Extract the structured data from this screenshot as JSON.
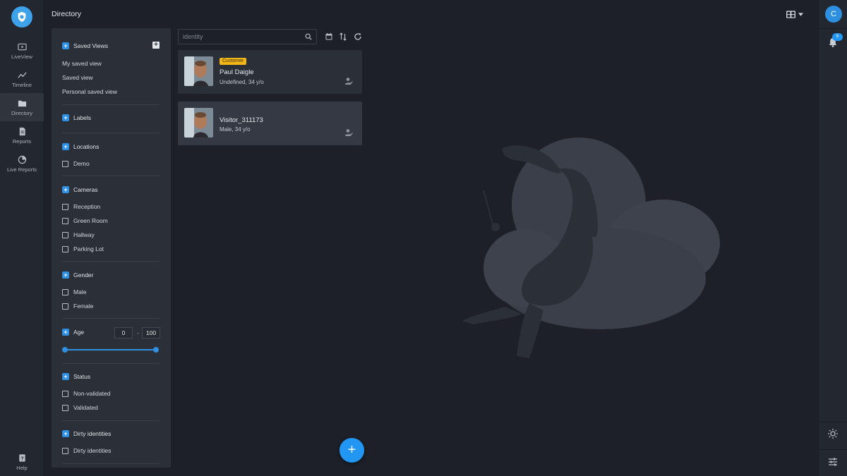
{
  "nav": {
    "items": [
      {
        "label": "LiveView",
        "icon": "tv-play-icon"
      },
      {
        "label": "Timeline",
        "icon": "trend-line-icon"
      },
      {
        "label": "Directory",
        "icon": "folder-icon"
      },
      {
        "label": "Reports",
        "icon": "document-icon"
      },
      {
        "label": "Live Reports",
        "icon": "pie-chart-icon"
      }
    ],
    "help_label": "Help",
    "active": "Directory"
  },
  "header": {
    "title": "Directory"
  },
  "user": {
    "initial": "C",
    "notifications": "6"
  },
  "filters": {
    "saved_views": {
      "title": "Saved Views",
      "items": [
        "My saved view",
        "Saved view",
        "Personal saved view"
      ]
    },
    "labels": {
      "title": "Labels"
    },
    "locations": {
      "title": "Locations",
      "items": [
        "Demo"
      ]
    },
    "cameras": {
      "title": "Cameras",
      "items": [
        "Reception",
        "Green Room",
        "Hallway",
        "Parking Lot"
      ]
    },
    "gender": {
      "title": "Gender",
      "items": [
        "Male",
        "Female"
      ]
    },
    "age": {
      "title": "Age",
      "min": "0",
      "max": "100",
      "separator": "-"
    },
    "status": {
      "title": "Status",
      "items": [
        "Non-validated",
        "Validated"
      ]
    },
    "dirty": {
      "title": "Dirty identities",
      "items": [
        "Dirty identities"
      ]
    }
  },
  "search": {
    "placeholder": "identity",
    "value": ""
  },
  "results": [
    {
      "tag": "Customer",
      "name": "Paul Daigle",
      "sub": "Undefined, 34 y/o"
    },
    {
      "tag": "",
      "name": "Visitor_311173",
      "sub": "Male, 34 y/o"
    }
  ],
  "fab_label": "+",
  "colors": {
    "accent": "#2196f3",
    "tag": "#f2b617",
    "background": "#1d2028",
    "panel": "#2b2f37"
  }
}
